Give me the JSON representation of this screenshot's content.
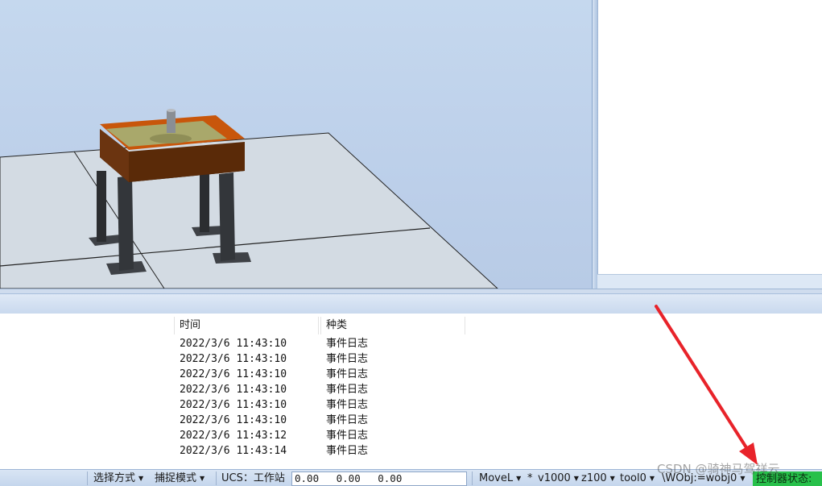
{
  "event_log": {
    "columns": {
      "time": "时间",
      "kind": "种类"
    },
    "rows": [
      {
        "time": "2022/3/6 11:43:10",
        "kind": "事件日志"
      },
      {
        "time": "2022/3/6 11:43:10",
        "kind": "事件日志"
      },
      {
        "time": "2022/3/6 11:43:10",
        "kind": "事件日志"
      },
      {
        "time": "2022/3/6 11:43:10",
        "kind": "事件日志"
      },
      {
        "time": "2022/3/6 11:43:10",
        "kind": "事件日志"
      },
      {
        "time": "2022/3/6 11:43:10",
        "kind": "事件日志"
      },
      {
        "time": "2022/3/6 11:43:12",
        "kind": "事件日志"
      },
      {
        "time": "2022/3/6 11:43:14",
        "kind": "事件日志"
      }
    ]
  },
  "status_bar": {
    "selection_mode": "选择方式",
    "snap_mode": "捕捉模式",
    "ucs": "UCS：工作站",
    "coordinates": "0.00 0.00 0.00",
    "move_type": "MoveL",
    "star": "*",
    "speed": "v1000",
    "zone": "z100",
    "tool": "tool0",
    "wobj": "\\WObj:=wobj0",
    "controller_status": "控制器状态:",
    "controller_status_color": "#27c04a"
  },
  "watermark": "CSDN @骑神马驾祥云",
  "icons": {
    "dropdown": "caret-down-icon",
    "annotation": "red-arrow-annotation"
  }
}
